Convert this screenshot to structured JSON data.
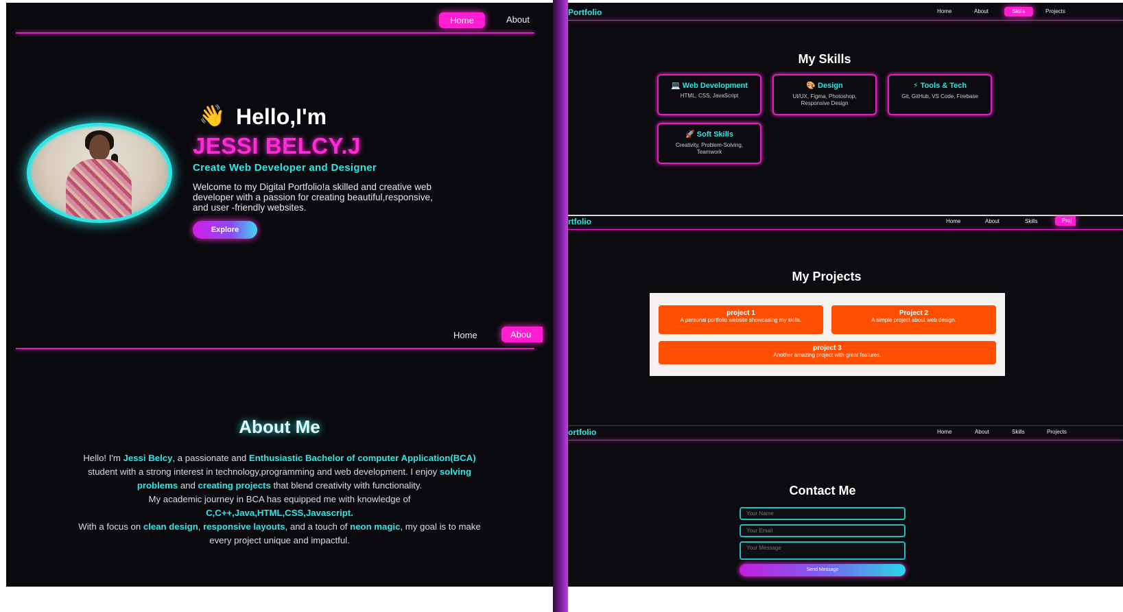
{
  "hero": {
    "nav": {
      "home": "Home",
      "about": "About"
    },
    "wave_emoji": "👋",
    "greeting": "Hello,I'm",
    "name": "JESSI BELCY.J",
    "role": "Create Web Developer and Designer",
    "intro": [
      "Welcome to my Digital Portfolio!a skilled and creative web",
      "developer with a passion for creating beautiful,responsive,",
      "and user -friendly websites."
    ],
    "explore_label": "Explore"
  },
  "about": {
    "nav": {
      "home": "Home",
      "about": "Abou"
    },
    "heading": "About Me",
    "line1": {
      "a": "Hello! I'm ",
      "b": "Jessi Belcy",
      "c": ", a passionate and ",
      "d": "Enthusiastic Bachelor of computer Application(BCA)"
    },
    "line2": {
      "a": "student with a strong interest in technology,programming and web development. I enjoy ",
      "b": "solving"
    },
    "line3": {
      "a": "problems",
      "b": " and ",
      "c": "creating projects",
      "d": " that blend creativity with functionality."
    },
    "line4": "My academic journey in BCA has equipped me with knowledge of",
    "line5": "C,C++,Java,HTML,CSS,Javascript.",
    "line6": {
      "a": "With a focus on ",
      "b": "clean design",
      "c": ", ",
      "d": "responsive layouts",
      "e": ", and a touch of ",
      "f": "neon magic",
      "g": ", my goal is to make"
    },
    "line7": "every project unique and impactful."
  },
  "skills_page": {
    "brand": "Portfolio",
    "nav": [
      "Home",
      "About",
      "Skills",
      "Projects"
    ],
    "heading": "My Skills",
    "cards": [
      {
        "icon": "💻",
        "title": "Web Development",
        "desc": "HTML, CSS, JavaScript"
      },
      {
        "icon": "🎨",
        "title": "Design",
        "desc": "UI/UX, Figma, Photoshop, Responsive Design"
      },
      {
        "icon": "⚡",
        "title": "Tools & Tech",
        "desc": "Git, GitHub, VS Code, Firebase"
      },
      {
        "icon": "🚀",
        "title": "Soft Skills",
        "desc": "Creativity, Problem-Solving, Teamwork"
      }
    ]
  },
  "projects_page": {
    "brand": "rtfolio",
    "nav": [
      "Home",
      "About",
      "Skills",
      "Proj"
    ],
    "heading": "My Projects",
    "projects": [
      {
        "title": "project 1",
        "desc": "A personal portfolio website showcasing my skills."
      },
      {
        "title": "Project 2",
        "desc": "A simple project about web design."
      },
      {
        "title": "project 3",
        "desc": "Another amazing project with great features."
      }
    ]
  },
  "contact_page": {
    "brand": "ortfolio",
    "nav": [
      "Home",
      "About",
      "Skills",
      "Projects"
    ],
    "heading": "Contact Me",
    "name_placeholder": "Your Name",
    "email_placeholder": "Your Email",
    "message_placeholder": "Your Message",
    "send_label": "Send Message"
  },
  "colors": {
    "pink": "#ff2bd8",
    "cyan": "#2ee6e6",
    "orange": "#ff4e00",
    "bg": "#0b0b10"
  }
}
